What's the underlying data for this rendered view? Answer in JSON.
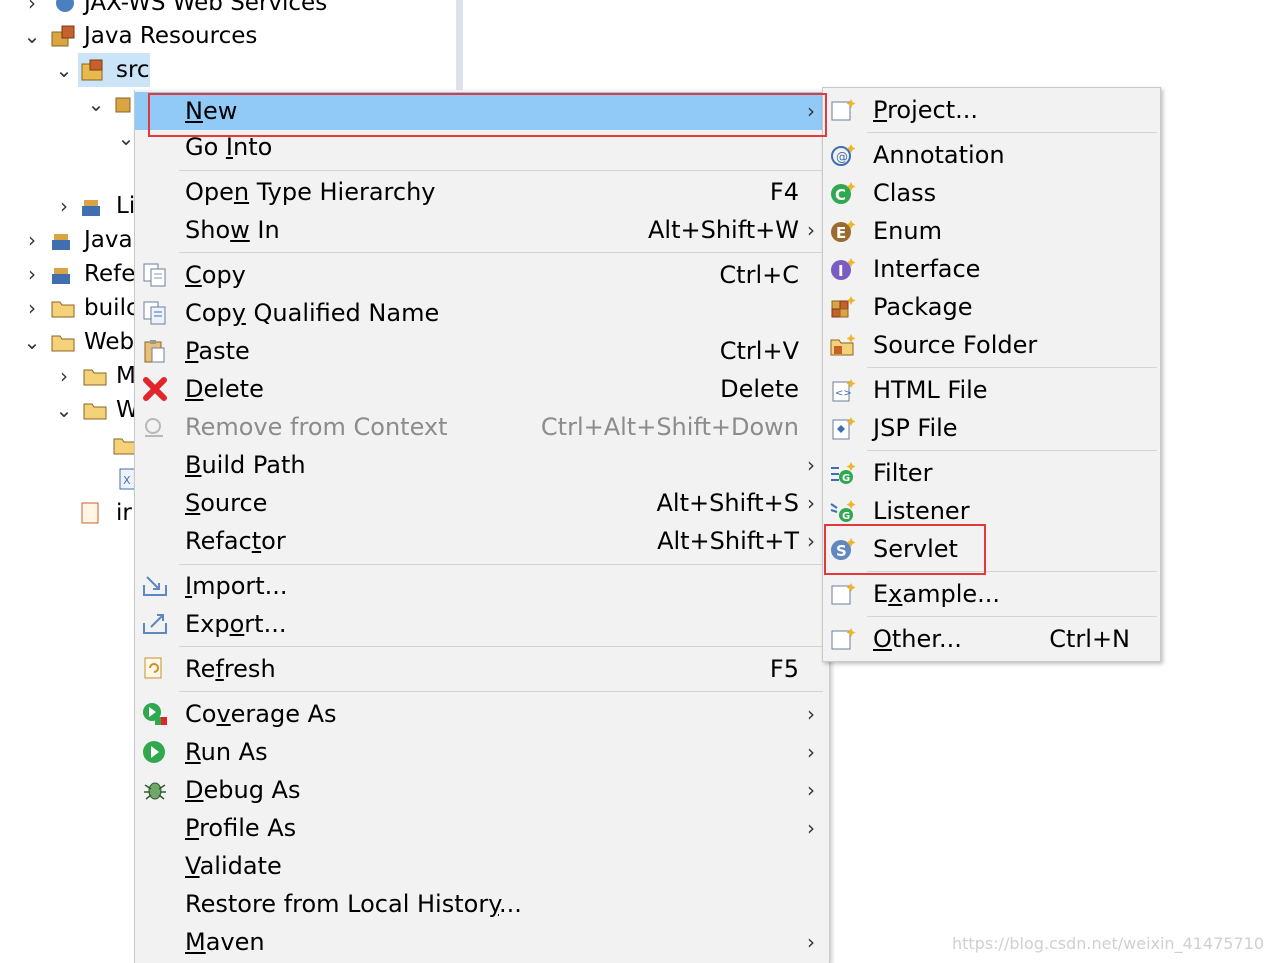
{
  "tree": {
    "items": [
      {
        "label": "JAX-WS Web Services"
      },
      {
        "label": "Java Resources"
      },
      {
        "label": "src"
      },
      {
        "label": "Li"
      },
      {
        "label": "Java"
      },
      {
        "label": "Refe"
      },
      {
        "label": "builc"
      },
      {
        "label": "Web"
      },
      {
        "label": "M"
      },
      {
        "label": "W"
      },
      {
        "label": "ir"
      }
    ]
  },
  "context_menu": {
    "items": [
      {
        "label": "New",
        "shortcut": "",
        "submenu": true,
        "highlighted": true
      },
      {
        "label": "Go Into",
        "shortcut": ""
      },
      {
        "label": "Open Type Hierarchy",
        "shortcut": "F4"
      },
      {
        "label": "Show In",
        "shortcut": "Alt+Shift+W",
        "submenu": true
      },
      {
        "label": "Copy",
        "shortcut": "Ctrl+C"
      },
      {
        "label": "Copy Qualified Name",
        "shortcut": ""
      },
      {
        "label": "Paste",
        "shortcut": "Ctrl+V"
      },
      {
        "label": "Delete",
        "shortcut": "Delete"
      },
      {
        "label": "Remove from Context",
        "shortcut": "Ctrl+Alt+Shift+Down",
        "disabled": true
      },
      {
        "label": "Build Path",
        "shortcut": "",
        "submenu": true
      },
      {
        "label": "Source",
        "shortcut": "Alt+Shift+S",
        "submenu": true
      },
      {
        "label": "Refactor",
        "shortcut": "Alt+Shift+T",
        "submenu": true
      },
      {
        "label": "Import...",
        "shortcut": ""
      },
      {
        "label": "Export...",
        "shortcut": ""
      },
      {
        "label": "Refresh",
        "shortcut": "F5"
      },
      {
        "label": "Coverage As",
        "shortcut": "",
        "submenu": true
      },
      {
        "label": "Run As",
        "shortcut": "",
        "submenu": true
      },
      {
        "label": "Debug As",
        "shortcut": "",
        "submenu": true
      },
      {
        "label": "Profile As",
        "shortcut": "",
        "submenu": true
      },
      {
        "label": "Validate",
        "shortcut": ""
      },
      {
        "label": "Restore from Local History...",
        "shortcut": ""
      },
      {
        "label": "Maven",
        "shortcut": "",
        "submenu": true
      }
    ]
  },
  "submenu": {
    "items": [
      {
        "label": "Project...",
        "shortcut": ""
      },
      {
        "label": "Annotation",
        "shortcut": ""
      },
      {
        "label": "Class",
        "shortcut": ""
      },
      {
        "label": "Enum",
        "shortcut": ""
      },
      {
        "label": "Interface",
        "shortcut": ""
      },
      {
        "label": "Package",
        "shortcut": ""
      },
      {
        "label": "Source Folder",
        "shortcut": ""
      },
      {
        "label": "HTML File",
        "shortcut": ""
      },
      {
        "label": "JSP File",
        "shortcut": ""
      },
      {
        "label": "Filter",
        "shortcut": ""
      },
      {
        "label": "Listener",
        "shortcut": ""
      },
      {
        "label": "Servlet",
        "shortcut": ""
      },
      {
        "label": "Example...",
        "shortcut": ""
      },
      {
        "label": "Other...",
        "shortcut": "Ctrl+N"
      }
    ]
  },
  "watermark": "https://blog.csdn.net/weixin_41475710",
  "colors": {
    "highlight": "#91c9f7",
    "annotation_box": "#e5383b",
    "menu_bg": "#f2f2f2"
  }
}
